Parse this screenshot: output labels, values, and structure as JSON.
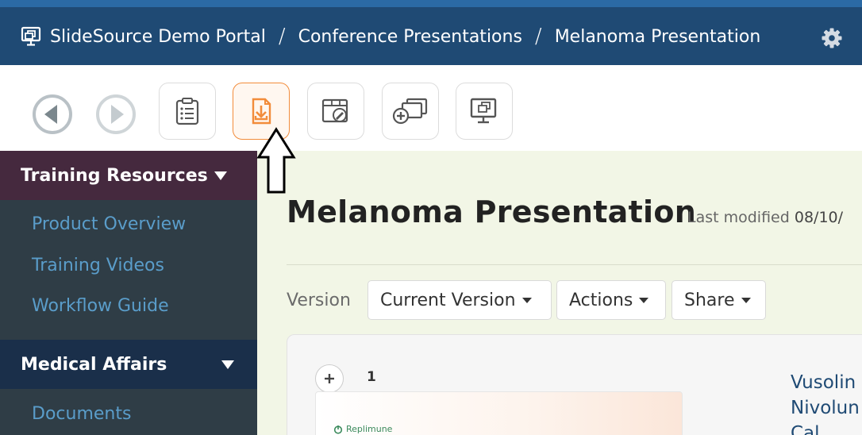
{
  "header": {
    "crumbs": [
      "SlideSource Demo Portal",
      "Conference Presentations",
      "Melanoma Presentation"
    ],
    "separator": "/",
    "icons": {
      "portal": "presentation-screen-icon",
      "settings": "gear-icon"
    }
  },
  "toolbar": {
    "buttons": [
      {
        "name": "back",
        "icon": "circle-left-arrow-icon"
      },
      {
        "name": "forward",
        "icon": "circle-right-arrow-icon"
      },
      {
        "name": "details",
        "icon": "clipboard-list-icon"
      },
      {
        "name": "download",
        "icon": "download-tray-icon",
        "active": true
      },
      {
        "name": "edit",
        "icon": "window-edit-icon"
      },
      {
        "name": "add-to-collection",
        "icon": "stack-plus-icon"
      },
      {
        "name": "present",
        "icon": "monitor-copy-icon"
      }
    ],
    "accent": "#f28c3b"
  },
  "sidebar": {
    "sections": [
      {
        "title": "Training Resources",
        "items": [
          "Product Overview",
          "Training Videos",
          "Workflow Guide"
        ]
      },
      {
        "title": "Medical Affairs",
        "items": [
          "Documents"
        ]
      }
    ]
  },
  "main": {
    "title": "Melanoma Presentation",
    "last_modified_label": "Last modified",
    "last_modified_value": "08/10/",
    "version_label": "Version",
    "version_select": "Current Version",
    "actions_label": "Actions",
    "share_label": "Share",
    "slide": {
      "number": "1",
      "thumb_logo_text": "Replimune",
      "title_lines": [
        "Vusolin",
        "Nivolun",
        "Cal"
      ]
    }
  },
  "colors": {
    "header_bg": "#1f4a74",
    "sidebar_bg": "#2f3d46",
    "section1_bg": "#45293e",
    "section2_bg": "#1a2f4a",
    "link": "#5a9dca",
    "main_bg": "#f2f6e6"
  }
}
